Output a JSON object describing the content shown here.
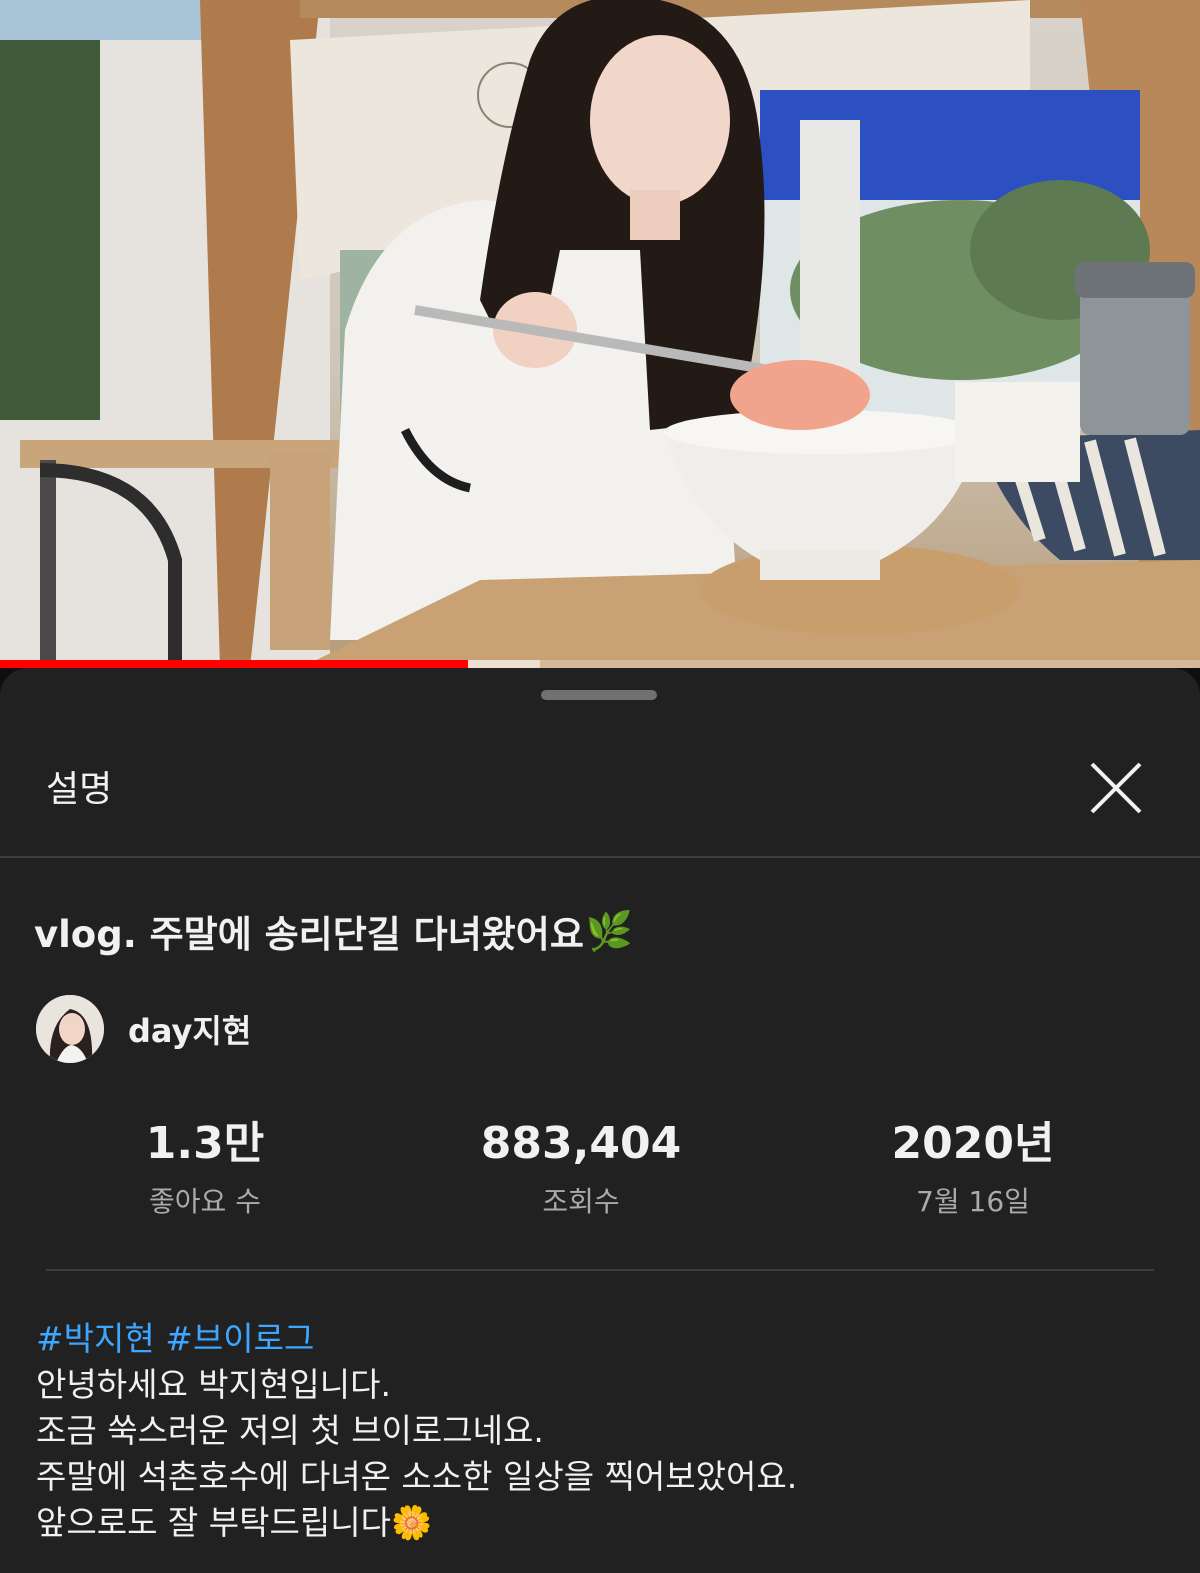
{
  "player": {
    "progress": 0.39,
    "buffered": 0.45,
    "accent_color": "#ff0000"
  },
  "sheet": {
    "title": "설명",
    "close_icon": "close-icon"
  },
  "video": {
    "title": "vlog. 주말에 송리단길 다녀왔어요",
    "title_emoji": "🌿",
    "channel_name": "day지현"
  },
  "stats": [
    {
      "value": "1.3만",
      "label": "좋아요 수"
    },
    {
      "value": "883,404",
      "label": "조회수"
    },
    {
      "value": "2020년",
      "label": "7월 16일"
    }
  ],
  "description": {
    "hashtags": [
      "#박지현",
      "#브이로그"
    ],
    "lines": [
      "안녕하세요 박지현입니다.",
      "조금 쑥스러운 저의 첫 브이로그네요.",
      "주말에 석촌호수에 다녀온 소소한 일상을 찍어보았어요.",
      "앞으로도 잘 부탁드립니다"
    ],
    "end_emoji": "🌼",
    "hashtag_color": "#3ea6ff"
  }
}
